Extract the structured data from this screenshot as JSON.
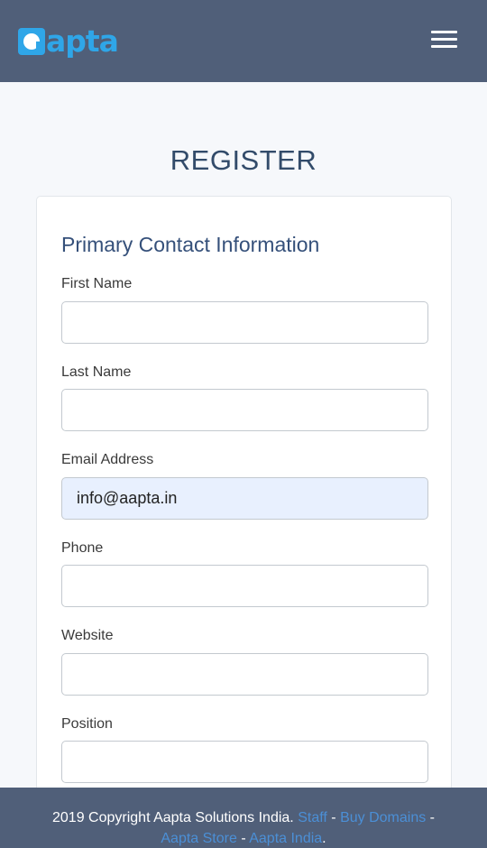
{
  "brand": {
    "logo_text": "apta",
    "accent_color": "#2fa6e8",
    "header_color": "#505f79"
  },
  "header": {
    "menu_icon": "hamburger-menu-icon"
  },
  "page": {
    "title": "REGISTER"
  },
  "form": {
    "section_title": "Primary Contact Information",
    "fields": [
      {
        "label": "First Name",
        "value": ""
      },
      {
        "label": "Last Name",
        "value": ""
      },
      {
        "label": "Email Address",
        "value": "info@aapta.in"
      },
      {
        "label": "Phone",
        "value": ""
      },
      {
        "label": "Website",
        "value": ""
      },
      {
        "label": "Position",
        "value": ""
      }
    ]
  },
  "footer": {
    "copyright": "2019 Copyright Aapta Solutions India.",
    "links": [
      "Staff",
      "Buy Domains",
      "Aapta Store",
      "Aapta India"
    ],
    "separator": "-",
    "end": "."
  }
}
